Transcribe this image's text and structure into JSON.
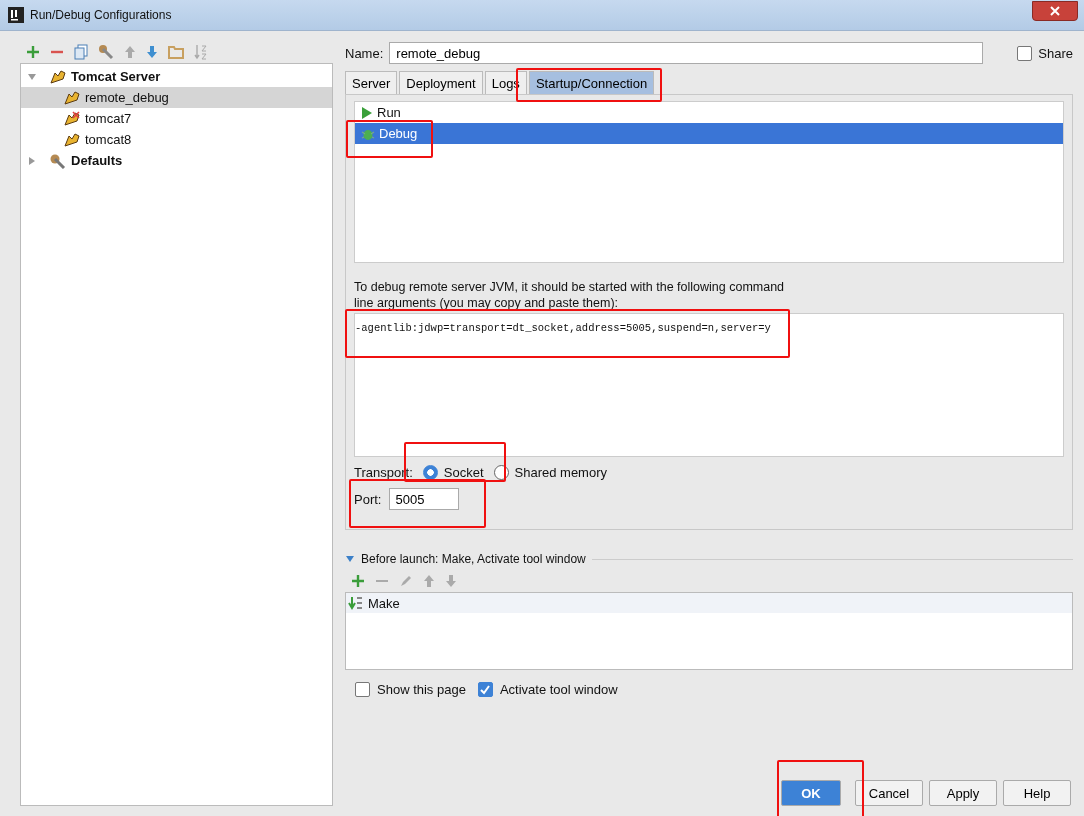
{
  "window": {
    "title": "Run/Debug Configurations"
  },
  "tree": [
    {
      "label": "Tomcat Server",
      "kind": "server",
      "expanded": true,
      "selected": false,
      "children": [
        {
          "label": "remote_debug",
          "selected": true,
          "error": false
        },
        {
          "label": "tomcat7",
          "selected": false,
          "error": true
        },
        {
          "label": "tomcat8",
          "selected": false,
          "error": false
        }
      ]
    },
    {
      "label": "Defaults",
      "kind": "defaults",
      "expanded": false,
      "selected": false
    }
  ],
  "name": {
    "label": "Name:",
    "value": "remote_debug"
  },
  "share": {
    "label": "Share",
    "checked": false
  },
  "tabs": [
    {
      "label": "Server",
      "selected": false
    },
    {
      "label": "Deployment",
      "selected": false
    },
    {
      "label": "Logs",
      "selected": false
    },
    {
      "label": "Startup/Connection",
      "selected": true
    }
  ],
  "modes": [
    {
      "label": "Run",
      "kind": "run",
      "selected": false
    },
    {
      "label": "Debug",
      "kind": "debug",
      "selected": true
    }
  ],
  "hint": "To debug remote server JVM, it should be started with the following command line arguments (you may copy and paste them):",
  "arguments": "-agentlib:jdwp=transport=dt_socket,address=5005,suspend=n,server=y",
  "transport": {
    "label": "Transport:",
    "options": [
      {
        "label": "Socket",
        "selected": true
      },
      {
        "label": "Shared memory",
        "selected": false
      }
    ]
  },
  "port": {
    "label": "Port:",
    "value": "5005"
  },
  "before_launch": {
    "title": "Before launch: Make, Activate tool window",
    "expanded": true,
    "items": [
      {
        "label": "Make",
        "selected": true
      }
    ]
  },
  "options": [
    {
      "label": "Show this page",
      "checked": false
    },
    {
      "label": "Activate tool window",
      "checked": true
    }
  ],
  "buttons": [
    {
      "label": "OK",
      "kind": "primary"
    },
    {
      "label": "Cancel",
      "kind": "normal"
    },
    {
      "label": "Apply",
      "kind": "normal"
    },
    {
      "label": "Help",
      "kind": "normal"
    }
  ]
}
